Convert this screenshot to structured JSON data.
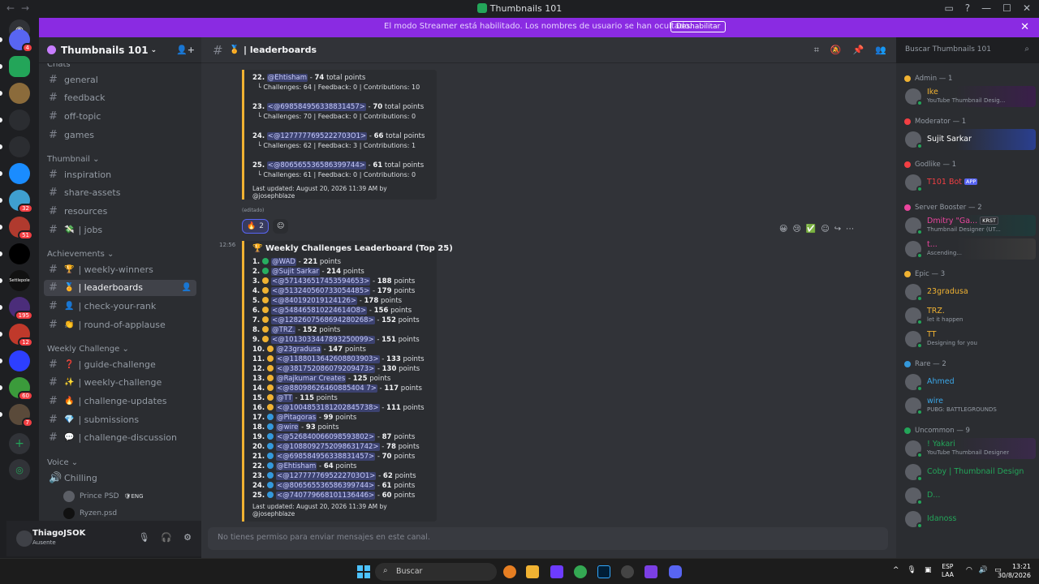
{
  "window": {
    "title": "Thumbnails 101"
  },
  "banner": {
    "text": "El modo Streamer está habilitado. Los nombres de usuario se han ocultado.",
    "button": "Deshabilitar"
  },
  "guilds": [
    {
      "label": "",
      "badge": "4",
      "color": "#5865f2"
    },
    {
      "label": "",
      "badge": "",
      "color": "#23a559"
    },
    {
      "label": "",
      "badge": "",
      "color": "#8b6b3b"
    },
    {
      "label": "",
      "badge": "",
      "color": "#2b2d31"
    },
    {
      "label": "",
      "badge": "",
      "color": "#2b2d31"
    },
    {
      "label": "",
      "badge": "",
      "color": "#1a8cff"
    },
    {
      "label": "",
      "badge": "32",
      "color": "#3f9fcf"
    },
    {
      "label": "",
      "badge": "51",
      "color": "#b03a2e"
    },
    {
      "label": "",
      "badge": "",
      "color": "#000000"
    },
    {
      "label": "Settlepole",
      "badge": "",
      "color": "#111111"
    },
    {
      "label": "",
      "badge": "195",
      "color": "#4b2d7a"
    },
    {
      "label": "",
      "badge": "12",
      "color": "#c0392b"
    },
    {
      "label": "",
      "badge": "",
      "color": "#2d3fff"
    },
    {
      "label": "",
      "badge": "60",
      "color": "#3b9b3b"
    },
    {
      "label": "",
      "badge": "7",
      "color": "#5a4a3a"
    }
  ],
  "server": {
    "name": "Thumbnails 101"
  },
  "categories": {
    "chats": "Chats",
    "thumbnail": "Thumbnail",
    "achievements": "Achievements",
    "weekly": "Weekly Challenge",
    "voice": "Voice"
  },
  "channels": {
    "chats": [
      "general",
      "feedback",
      "off-topic",
      "games"
    ],
    "thumbnail": [
      {
        "name": "inspiration",
        "emoji": ""
      },
      {
        "name": "share-assets",
        "emoji": ""
      },
      {
        "name": "resources",
        "emoji": ""
      },
      {
        "name": "| jobs",
        "emoji": "💸"
      }
    ],
    "achievements": [
      {
        "name": "| weekly-winners",
        "emoji": "🏆"
      },
      {
        "name": "| leaderboards",
        "emoji": "🏅"
      },
      {
        "name": "| check-your-rank",
        "emoji": "👤"
      },
      {
        "name": "| round-of-applause",
        "emoji": "👏"
      }
    ],
    "weekly": [
      {
        "name": "| guide-challenge",
        "emoji": "❓"
      },
      {
        "name": "| weekly-challenge",
        "emoji": "✨"
      },
      {
        "name": "| challenge-updates",
        "emoji": "🔥"
      },
      {
        "name": "| submissions",
        "emoji": "💎"
      },
      {
        "name": "| challenge-discussion",
        "emoji": "💬"
      }
    ],
    "voice": {
      "name": "Chilling",
      "users": [
        {
          "name": "Prince PSD",
          "tag": "ENG"
        },
        {
          "name": "Ryzen.psd",
          "tag": ""
        }
      ]
    }
  },
  "user": {
    "name": "ThiagoJSOK",
    "status": "Ausente"
  },
  "chat": {
    "channel": "| leaderboards",
    "search_placeholder": "Buscar Thumbnails 101",
    "input_placeholder": "No tienes permiso para enviar mensajes en este canal.",
    "edited": "(editado)",
    "reactions": [
      {
        "emoji": "🔥",
        "count": "2"
      },
      {
        "emoji": "☺",
        "count": ""
      }
    ],
    "time2": "12:56",
    "msg1": {
      "entries": [
        {
          "rank": "22.",
          "name": "@Ehtisham",
          "pts": "74",
          "detail": "Challenges: 64 | Feedback: 0 | Contributions: 10"
        },
        {
          "rank": "23.",
          "name": "<@698584956338831457>",
          "pts": "70",
          "detail": "Challenges: 70 | Feedback: 0 | Contributions: 0"
        },
        {
          "rank": "24.",
          "name": "<@1277777695222703O1>",
          "pts": "66",
          "detail": "Challenges: 62 | Feedback: 3 | Contributions: 1"
        },
        {
          "rank": "25.",
          "name": "<@806565536586399744>",
          "pts": "61",
          "detail": "Challenges: 61 | Feedback: 0 | Contributions: 0"
        }
      ],
      "pts_suffix": "total points",
      "footer": "Last updated: August 20, 2026 11:39 AM by @josephblaze"
    },
    "msg2": {
      "title": "Weekly Challenges Leaderboard (Top 25)",
      "rows": [
        {
          "rank": "1.",
          "medal": "green",
          "name": "@WAD",
          "pts": "221"
        },
        {
          "rank": "2.",
          "medal": "green",
          "name": "@Sujit Sarkar",
          "pts": "214"
        },
        {
          "rank": "3.",
          "medal": "gold",
          "name": "<@571436517453594653>",
          "pts": "188"
        },
        {
          "rank": "4.",
          "medal": "gold",
          "name": "<@513240560733054485>",
          "pts": "179"
        },
        {
          "rank": "5.",
          "medal": "gold",
          "name": "<@840192019124126>",
          "pts": "178"
        },
        {
          "rank": "6.",
          "medal": "gold",
          "name": "<@548465810224614O8>",
          "pts": "156"
        },
        {
          "rank": "7.",
          "medal": "gold",
          "name": "<@1282607568694280268>",
          "pts": "152"
        },
        {
          "rank": "8.",
          "medal": "gold",
          "name": "@TRZ.",
          "pts": "152"
        },
        {
          "rank": "9.",
          "medal": "gold",
          "name": "<@1013033447893250099>",
          "pts": "151"
        },
        {
          "rank": "10.",
          "medal": "gold",
          "name": "@23gradusa",
          "pts": "147"
        },
        {
          "rank": "11.",
          "medal": "gold",
          "name": "<@1188013642608803903>",
          "pts": "133"
        },
        {
          "rank": "12.",
          "medal": "gold",
          "name": "<@381752086079209473>",
          "pts": "130"
        },
        {
          "rank": "13.",
          "medal": "gold",
          "name": "@Rajkumar Creates",
          "pts": "125"
        },
        {
          "rank": "14.",
          "medal": "gold",
          "name": "<@88098626460885404 7>",
          "pts": "117"
        },
        {
          "rank": "15.",
          "medal": "gold",
          "name": "@TT",
          "pts": "115"
        },
        {
          "rank": "16.",
          "medal": "gold",
          "name": "<@1004853181202845738>",
          "pts": "111"
        },
        {
          "rank": "17.",
          "medal": "blue",
          "name": "@Pitagoras",
          "pts": "99"
        },
        {
          "rank": "18.",
          "medal": "blue",
          "name": "@wire",
          "pts": "93"
        },
        {
          "rank": "19.",
          "medal": "blue",
          "name": "<@526840066098593802>",
          "pts": "87"
        },
        {
          "rank": "20.",
          "medal": "blue",
          "name": "<@1088092752098631742>",
          "pts": "78"
        },
        {
          "rank": "21.",
          "medal": "blue",
          "name": "<@698584956338831457>",
          "pts": "70"
        },
        {
          "rank": "22.",
          "medal": "blue",
          "name": "@Ehtisham",
          "pts": "64"
        },
        {
          "rank": "23.",
          "medal": "blue",
          "name": "<@1277777695222703O1>",
          "pts": "62"
        },
        {
          "rank": "24.",
          "medal": "blue",
          "name": "<@806565536586399744>",
          "pts": "61"
        },
        {
          "rank": "25.",
          "medal": "blue",
          "name": "<@740779668101136446>",
          "pts": "60"
        }
      ],
      "pts_suffix": "points",
      "footer": "Last updated: August 20, 2026 11:39 AM by @josephblaze"
    }
  },
  "members": {
    "groups": [
      {
        "label": "Admin — 1",
        "color": "#f0b232",
        "users": [
          {
            "name": "Ike",
            "sub": "YouTube Thumbnail Desig...",
            "color": "#f0b232",
            "banner": "#3a1f4a"
          }
        ]
      },
      {
        "label": "Moderator — 1",
        "color": "#f23f43",
        "users": [
          {
            "name": "Sujit Sarkar",
            "sub": "",
            "color": "#ffffff",
            "banner": "#2a3f8f"
          }
        ]
      },
      {
        "label": "Godlike — 1",
        "color": "#f23f43",
        "users": [
          {
            "name": "T101 Bot",
            "sub": "",
            "color": "#f23f43",
            "banner": "",
            "app": "APP"
          }
        ]
      },
      {
        "label": "Server Booster — 2",
        "color": "#eb459e",
        "users": [
          {
            "name": "Dmitry \"Ga...",
            "sub": "Thumbnail Designer (UT...",
            "color": "#eb459e",
            "banner": "#1f3a3a",
            "tag": "KRST"
          },
          {
            "name": "t...",
            "sub": "Ascending...",
            "color": "#eb459e",
            "banner": "#3a3a3a"
          }
        ]
      },
      {
        "label": "Epic — 3",
        "color": "#f0b232",
        "users": [
          {
            "name": "23gradusa",
            "sub": "",
            "color": "#f0b232",
            "banner": ""
          },
          {
            "name": "TRZ.",
            "sub": "let it happen",
            "color": "#f0b232",
            "banner": ""
          },
          {
            "name": "TT",
            "sub": "Designing for you",
            "color": "#f0b232",
            "banner": ""
          }
        ]
      },
      {
        "label": "Rare — 2",
        "color": "#3498db",
        "users": [
          {
            "name": "Ahmed",
            "sub": "",
            "color": "#3ba7e8",
            "banner": ""
          },
          {
            "name": "wire",
            "sub": "PUBG: BATTLEGROUNDS",
            "color": "#3ba7e8",
            "banner": ""
          }
        ]
      },
      {
        "label": "Uncommon — 9",
        "color": "#23a559",
        "users": [
          {
            "name": "! Yakari",
            "sub": "YouTube Thumbnail Designer",
            "color": "#23a559",
            "banner": "#3a2a4a"
          },
          {
            "name": "Coby | Thumbnail Design",
            "sub": "",
            "color": "#23a559",
            "banner": ""
          },
          {
            "name": "D...",
            "sub": "",
            "color": "#23a559",
            "banner": ""
          },
          {
            "name": "Idanoss",
            "sub": "",
            "color": "#23a559",
            "banner": ""
          }
        ]
      }
    ]
  },
  "taskbar": {
    "search": "Buscar",
    "lang1": "ESP",
    "lang2": "LAA",
    "time": "13:21",
    "date": "30/8/2026"
  }
}
